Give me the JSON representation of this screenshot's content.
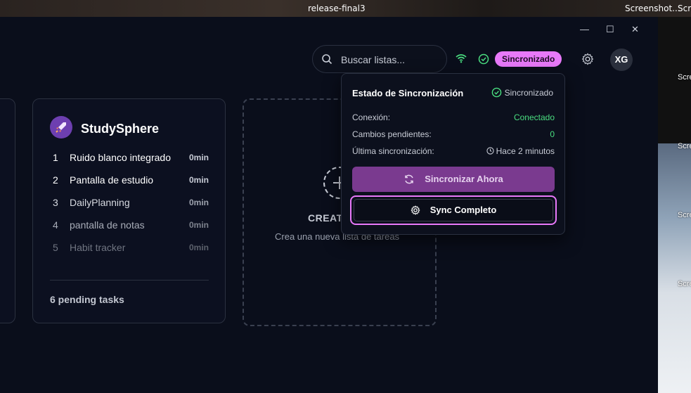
{
  "taskbar": {
    "title": "release-final3",
    "right_label": "Screenshot...",
    "right_label2": "Scre"
  },
  "desktop_labels": [
    "Scre",
    "Scre",
    "Scre",
    "Scre"
  ],
  "window_controls": {
    "minimize": "—",
    "maximize": "☐",
    "close": "✕"
  },
  "header": {
    "search_placeholder": "Buscar listas...",
    "sync_badge": "Sincronizado",
    "avatar_initials": "XG"
  },
  "list_card": {
    "title": "StudySphere",
    "items": [
      {
        "num": "1",
        "name": "Ruido blanco integrado",
        "duration": "0min"
      },
      {
        "num": "2",
        "name": "Pantalla de estudio",
        "duration": "0min"
      },
      {
        "num": "3",
        "name": "DailyPlanning",
        "duration": "0min"
      },
      {
        "num": "4",
        "name": "pantalla de notas",
        "duration": "0min"
      },
      {
        "num": "5",
        "name": "Habit tracker",
        "duration": "0min"
      }
    ],
    "pending": "6 pending tasks"
  },
  "create_card": {
    "title": "CREAT",
    "subtitle": "Crea una nueva lista de tareas"
  },
  "sync_popover": {
    "title": "Estado de Sincronización",
    "status": "Sincronizado",
    "rows": [
      {
        "label": "Conexión:",
        "value": "Conectado"
      },
      {
        "label": "Cambios pendientes:",
        "value": "0"
      },
      {
        "label": "Última sincronización:",
        "value": "Hace 2 minutos"
      }
    ],
    "sync_now_label": "Sincronizar Ahora",
    "full_sync_label": "Sync Completo"
  },
  "colors": {
    "accent": "#e879f9",
    "success": "#4ade80",
    "bg": "#0a0e1b",
    "button": "#7a3a8f"
  }
}
